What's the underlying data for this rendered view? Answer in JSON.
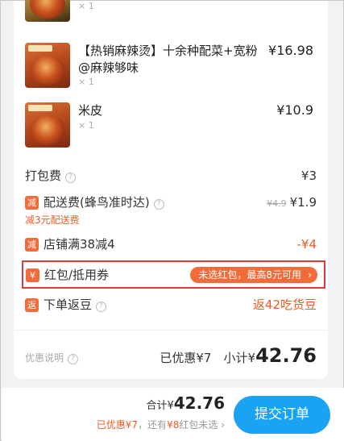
{
  "items": [
    {
      "name": "",
      "qty": "× 1",
      "price": ""
    },
    {
      "name": "【热销麻辣烫】十余种配菜+宽粉@麻辣够味",
      "qty": "× 1",
      "price": "¥16.98"
    },
    {
      "name": "米皮",
      "qty": "× 1",
      "price": "¥10.9"
    }
  ],
  "fees": {
    "packing_label": "打包费",
    "packing_value": "¥3",
    "delivery_badge": "减",
    "delivery_label": "配送费(蜂鸟准时达)",
    "delivery_original": "¥4.9",
    "delivery_value": "¥1.9",
    "delivery_note": "减3元配送费",
    "store_badge": "减",
    "store_label": "店铺满38减4",
    "store_value": "-¥4",
    "coupon_badge": "¥",
    "coupon_label": "红包/抵用券",
    "coupon_pill": "未选红包，最高8元可用",
    "coupon_chevron": "›",
    "bean_badge": "返",
    "bean_label": "下单返豆",
    "bean_value": "返42吃货豆"
  },
  "summary": {
    "discount_note": "优惠说明",
    "discounted_label": "已优惠",
    "discounted_value": "¥7",
    "subtotal_label": "小计¥",
    "subtotal_value": "42.76"
  },
  "footer": {
    "total_label": "合计¥",
    "total_value": "42.76",
    "note_part1": "已优惠¥7",
    "note_part2": "，还有",
    "note_part3": "¥8",
    "note_part4": "红包未选",
    "note_chevron": "›",
    "submit_label": "提交订单"
  },
  "colors": {
    "accent": "#f05a24",
    "button": "#1aa3f2",
    "highlight_border": "#e23a3a"
  }
}
